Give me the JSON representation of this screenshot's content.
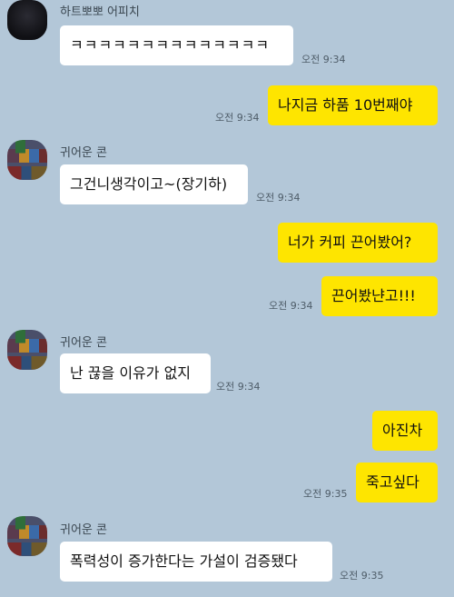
{
  "messages": [
    {
      "sender": "하트뽀뽀 어피치",
      "text": "ㅋㅋㅋㅋㅋㅋㅋㅋㅋㅋㅋㅋㅋㅋ",
      "time": "오전 9:34"
    },
    {
      "sender": "me",
      "text": "나지금 하품 10번째야",
      "time": "오전 9:34"
    },
    {
      "sender": "귀어운 콘",
      "text": "그건니생각이고~(장기하)",
      "time": "오전 9:34"
    },
    {
      "sender": "me",
      "text": "너가 커피 끈어봤어?"
    },
    {
      "sender": "me",
      "text": "끈어봤냔고!!!",
      "time": "오전 9:34"
    },
    {
      "sender": "귀어운 콘",
      "text": "난 끊을 이유가 없지",
      "time": "오전 9:34"
    },
    {
      "sender": "me",
      "text": "아진차"
    },
    {
      "sender": "me",
      "text": "죽고싶다",
      "time": "오전 9:35"
    },
    {
      "sender": "귀어운 콘",
      "text": "폭력성이 증가한다는 가설이 검증됐다",
      "time": "오전 9:35"
    }
  ],
  "colors": {
    "background": "#b3c7d8",
    "incoming": "#ffffff",
    "outgoing": "#fee500"
  }
}
